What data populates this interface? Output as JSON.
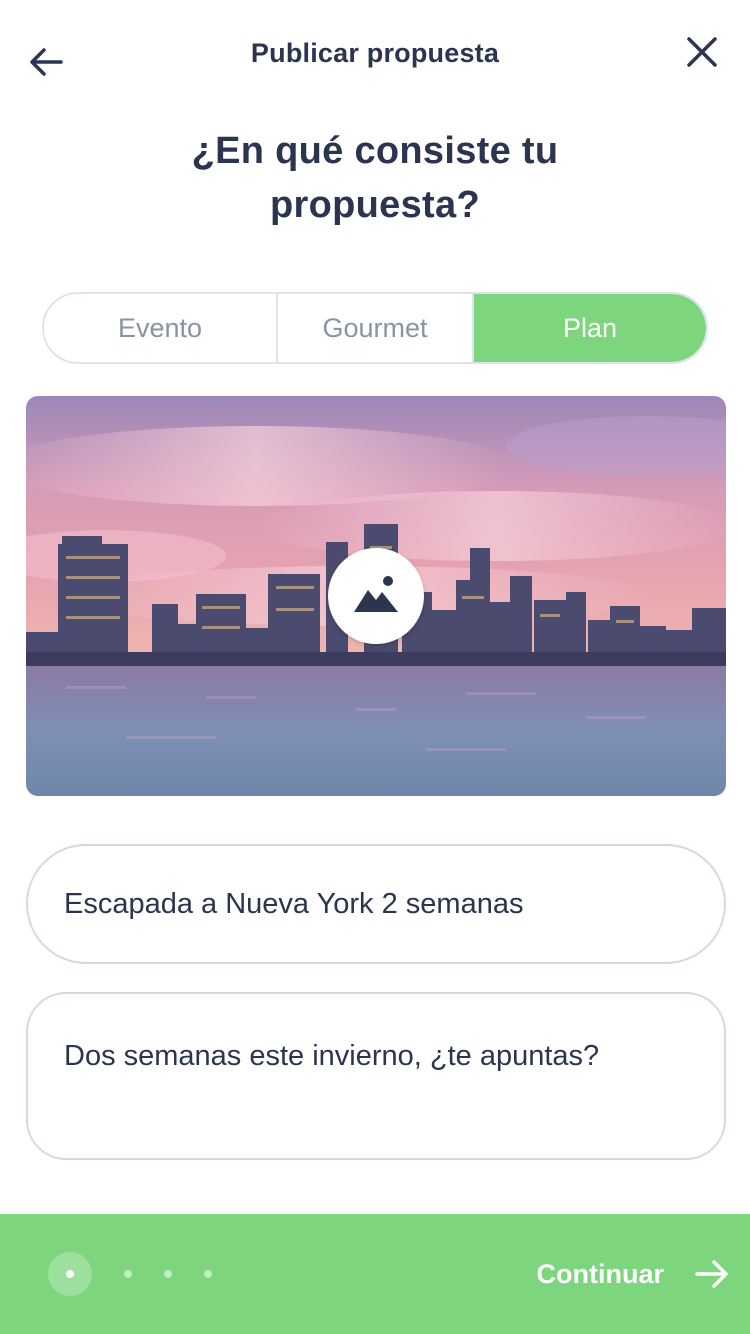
{
  "header": {
    "title": "Publicar propuesta",
    "back_icon": "arrow-left-icon",
    "close_icon": "close-icon"
  },
  "question": "¿En qué consiste tu propuesta?",
  "categories": {
    "items": [
      "Evento",
      "Gourmet",
      "Plan"
    ],
    "selected": "Plan"
  },
  "photo": {
    "icon": "image-icon"
  },
  "form": {
    "title_value": "Escapada a Nueva York 2 semanas",
    "description_value": "Dos semanas este invierno, ¿te apuntas?"
  },
  "footer": {
    "continue_label": "Continuar",
    "continue_icon": "arrow-right-icon",
    "steps_total": 4,
    "current_step": 1
  },
  "colors": {
    "accent": "#7dd67e",
    "text": "#2b3550",
    "muted": "#8a93a6",
    "border": "#d4dae4"
  }
}
